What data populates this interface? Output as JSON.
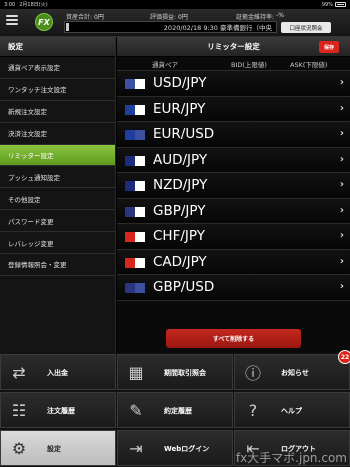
{
  "status_bar": {
    "time": "3:00",
    "date": "2月18日(火)",
    "battery": "99%"
  },
  "header": {
    "stats": [
      {
        "label": "資産合計:",
        "value": "0円"
      },
      {
        "label": "評価損益:",
        "value": "0円"
      },
      {
        "label": "証拠金維持率:",
        "value": "-%"
      }
    ],
    "ticker": "2020/02/18 9:30 豪準備銀行（中央",
    "account_status_button": "口座状況照会"
  },
  "sidebar": {
    "title": "設定",
    "items": [
      {
        "label": "通貨ペア表示設定",
        "active": false
      },
      {
        "label": "ワンタッチ注文設定",
        "active": false
      },
      {
        "label": "新規注文設定",
        "active": false
      },
      {
        "label": "決済注文設定",
        "active": false
      },
      {
        "label": "リミッター設定",
        "active": true
      },
      {
        "label": "プッシュ通知設定",
        "active": false
      },
      {
        "label": "その他設定",
        "active": false
      },
      {
        "label": "パスワード変更",
        "active": false
      },
      {
        "label": "レバレッジ変更",
        "active": false
      },
      {
        "label": "登録情報照会・変更",
        "active": false
      }
    ]
  },
  "panel": {
    "title": "リミッター設定",
    "save_label": "保存",
    "columns": {
      "pair": "通貨ペア",
      "bid": "BID(上限値)",
      "ask": "ASK(下限値)"
    },
    "pairs": [
      {
        "name": "USD/JPY",
        "flag_left": "#3c4fa0",
        "flag_right": "#ffffff"
      },
      {
        "name": "EUR/JPY",
        "flag_left": "#1f3e9e",
        "flag_right": "#ffffff"
      },
      {
        "name": "EUR/USD",
        "flag_left": "#1f3e9e",
        "flag_right": "#3c4fa0"
      },
      {
        "name": "AUD/JPY",
        "flag_left": "#1d2c7a",
        "flag_right": "#ffffff"
      },
      {
        "name": "NZD/JPY",
        "flag_left": "#1d2c7a",
        "flag_right": "#ffffff"
      },
      {
        "name": "GBP/JPY",
        "flag_left": "#2a3580",
        "flag_right": "#ffffff"
      },
      {
        "name": "CHF/JPY",
        "flag_left": "#d8261c",
        "flag_right": "#ffffff"
      },
      {
        "name": "CAD/JPY",
        "flag_left": "#d8261c",
        "flag_right": "#ffffff"
      },
      {
        "name": "GBP/USD",
        "flag_left": "#2a3580",
        "flag_right": "#3c4fa0"
      }
    ],
    "delete_all_label": "すべて削除する"
  },
  "bottom_menu": [
    {
      "label": "入出金",
      "icon": "transfer-icon",
      "active": false
    },
    {
      "label": "期間取引照会",
      "icon": "calendar-icon",
      "active": false
    },
    {
      "label": "お知らせ",
      "icon": "info-icon",
      "active": false,
      "badge": "22"
    },
    {
      "label": "注文履歴",
      "icon": "document-icon",
      "active": false
    },
    {
      "label": "約定履歴",
      "icon": "contract-icon",
      "active": false
    },
    {
      "label": "ヘルプ",
      "icon": "help-icon",
      "active": false
    },
    {
      "label": "設定",
      "icon": "gear-icon",
      "active": true
    },
    {
      "label": "Webログイン",
      "icon": "web-login-icon",
      "active": false
    },
    {
      "label": "ログアウト",
      "icon": "logout-icon",
      "active": false
    }
  ],
  "watermark": "fx大手マボ.jpn.com",
  "colors": {
    "accent_green": "#7cb82f",
    "accent_red": "#d8261c"
  }
}
